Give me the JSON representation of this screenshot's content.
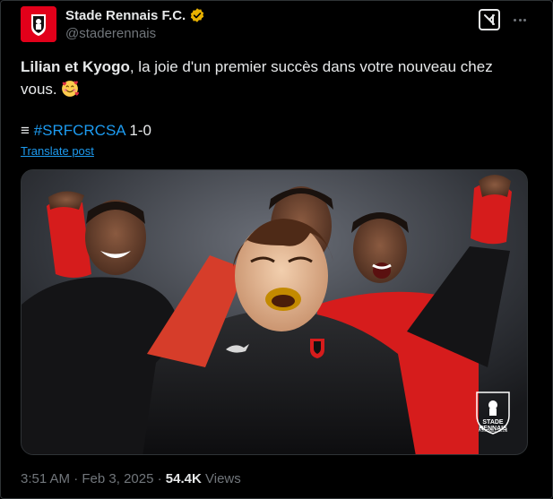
{
  "account": {
    "display_name": "Stade Rennais F.C.",
    "handle": "@staderennais",
    "verified_color": "#e8b100"
  },
  "tweet": {
    "bold_names": "Lilian et Kyogo",
    "text": ", la joie d'un premier succès dans votre nouveau chez vous.",
    "emoji": "smiling-face-with-hearts-icon",
    "score_prefix": "≡",
    "hashtag": "#SRFCRCSA",
    "score": "1-0",
    "translate_label": "Translate post"
  },
  "photo": {
    "crest_text": "STADE RENNAIS",
    "crest_subtext": "FOOTBALL CLUB"
  },
  "meta": {
    "time": "3:51 AM",
    "separator": "·",
    "date": "Feb 3, 2025",
    "views_count": "54.4K",
    "views_label": "Views"
  },
  "colors": {
    "background": "#000000",
    "text": "#e7e9ea",
    "muted": "#71767b",
    "link": "#1d9bf0",
    "brand_red": "#e2001a"
  }
}
